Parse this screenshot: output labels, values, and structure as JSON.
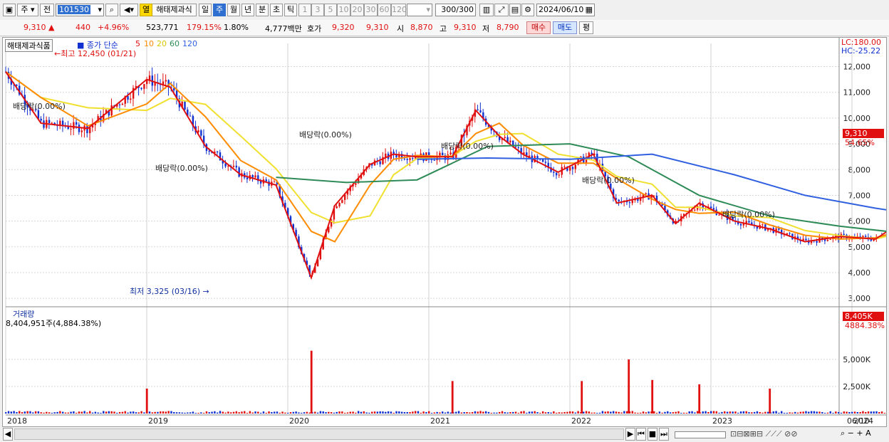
{
  "toolbar": {
    "mode_label": "주",
    "prev_label": "전",
    "stock_code": "101530",
    "open_label": "열",
    "stock_name": "해태제과식",
    "periods": [
      "일",
      "주",
      "월",
      "년",
      "분",
      "초",
      "틱"
    ],
    "selected_period": "주",
    "intervals": [
      "1",
      "3",
      "5",
      "10",
      "20",
      "30",
      "60",
      "120"
    ],
    "count": "300/300",
    "date": "2024/06/10"
  },
  "quote": {
    "price": "9,310",
    "change": "440",
    "change_pct": "+4.96%",
    "volume": "523,771",
    "volume_ratio": "179.15%",
    "turnover": "1.80%",
    "amount": "4,777백만",
    "ask_label": "호가",
    "ask1": "9,320",
    "ask2": "9,310",
    "open_label": "시",
    "open": "8,870",
    "high_label": "고",
    "high": "9,310",
    "low_label": "저",
    "low": "8,790",
    "buy_label": "매수",
    "sell_label": "매도",
    "flat_label": "평"
  },
  "legend": {
    "name": "해태제과식품",
    "ma_label": "종가 단순",
    "ma_periods": [
      "5",
      "10",
      "20",
      "60",
      "120"
    ]
  },
  "annotations": {
    "high_label": "최고 12,450 (01/21)",
    "low_label": "최저 3,325 (03/16)",
    "dividend_label": "배당락(0.00%)",
    "lc": "LC:180.00",
    "hc": "HC:-25.22",
    "last_price": "9,310",
    "last_pct": "54.65%",
    "vol_title": "거래량",
    "vol_info": "8,404,951주(4,884.38%)",
    "vol_last": "8,405K",
    "vol_last_pct": "4884.38%"
  },
  "colors": {
    "up": "#e01010",
    "down": "#1030d0",
    "ma5": "#e01010",
    "ma10": "#ff8c00",
    "ma20": "#f0e030",
    "ma60": "#2e8b57",
    "ma120": "#3060e0"
  },
  "chart_data": [
    {
      "type": "candlestick",
      "title": "해태제과식품",
      "x_ticks": [
        "2018",
        "2019",
        "2020",
        "2021",
        "2022",
        "2023",
        "2024",
        "06/10"
      ],
      "y_ticks": [
        3000,
        4000,
        5000,
        6000,
        7000,
        8000,
        9000,
        10000,
        11000,
        12000
      ],
      "ylim": [
        2700,
        12900
      ],
      "series": [
        {
          "name": "종가",
          "points": [
            [
              "2018/01",
              11800
            ],
            [
              "2018/04",
              9800
            ],
            [
              "2018/08",
              9600
            ],
            [
              "2019/01",
              11500
            ],
            [
              "2019/03",
              11200
            ],
            [
              "2019/06",
              8900
            ],
            [
              "2019/09",
              7800
            ],
            [
              "2019/12",
              7400
            ],
            [
              "2020/03",
              3800
            ],
            [
              "2020/05",
              6600
            ],
            [
              "2020/08",
              8200
            ],
            [
              "2020/10",
              8600
            ],
            [
              "2020/12",
              8500
            ],
            [
              "2021/03",
              8500
            ],
            [
              "2021/05",
              10300
            ],
            [
              "2021/07",
              9300
            ],
            [
              "2021/09",
              8600
            ],
            [
              "2021/12",
              7900
            ],
            [
              "2022/03",
              8600
            ],
            [
              "2022/05",
              6700
            ],
            [
              "2022/08",
              7000
            ],
            [
              "2022/10",
              5900
            ],
            [
              "2022/12",
              6700
            ],
            [
              "2023/03",
              6000
            ],
            [
              "2023/06",
              5700
            ],
            [
              "2023/09",
              5200
            ],
            [
              "2023/12",
              5400
            ],
            [
              "2024/03",
              5300
            ],
            [
              "2024/05",
              5900
            ],
            [
              "2024/06/10",
              9310
            ]
          ]
        },
        {
          "name": "120",
          "points": [
            [
              "2020/12",
              8400
            ],
            [
              "2021/06",
              8450
            ],
            [
              "2022/01",
              8400
            ],
            [
              "2022/08",
              8600
            ],
            [
              "2023/03",
              7800
            ],
            [
              "2023/09",
              7000
            ],
            [
              "2024/03",
              6500
            ],
            [
              "2024/06",
              6300
            ]
          ]
        },
        {
          "name": "60",
          "points": [
            [
              "2019/12",
              7700
            ],
            [
              "2020/06",
              7500
            ],
            [
              "2020/12",
              7600
            ],
            [
              "2021/06",
              8900
            ],
            [
              "2022/01",
              9000
            ],
            [
              "2022/06",
              8500
            ],
            [
              "2022/12",
              7000
            ],
            [
              "2023/06",
              6200
            ],
            [
              "2023/12",
              5800
            ],
            [
              "2024/06",
              5500
            ]
          ]
        }
      ]
    },
    {
      "type": "bar",
      "title": "거래량",
      "y_ticks": [
        "2,500K",
        "5,000K"
      ],
      "values_k": [
        [
          "2019/01",
          2300
        ],
        [
          "2020/03",
          5800
        ],
        [
          "2021/03",
          3000
        ],
        [
          "2022/02",
          3000
        ],
        [
          "2022/06",
          5000
        ],
        [
          "2022/08",
          3100
        ],
        [
          "2022/12",
          2700
        ],
        [
          "2023/06",
          2300
        ],
        [
          "2024/06/10",
          8405
        ]
      ]
    }
  ]
}
